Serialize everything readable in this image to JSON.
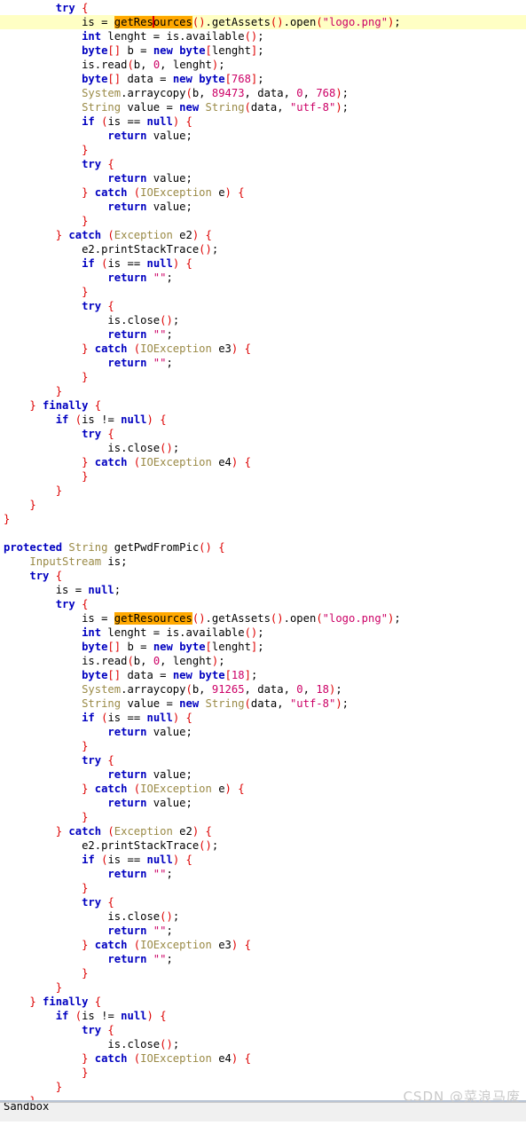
{
  "editor": {
    "language": "java",
    "current_line_index": 1,
    "caret": {
      "line_index": 1,
      "token": "getRes|ources"
    },
    "colors": {
      "background": "#ffffff",
      "current_line_highlight": "#ffffc4",
      "occurrence_highlight": "#ffa800",
      "keyword": "#0000c0",
      "type": "#9a8a46",
      "string": "#cc0066",
      "number": "#cc0066",
      "punctuation": "#dd0000",
      "plain": "#000000",
      "caret": "#e00000",
      "watermark": "#c9c9c9",
      "rule": "#b9c4d4",
      "status_bar": "#f0f0f0"
    },
    "lines": [
      "        try {",
      "            is = getResources().getAssets().open(\"logo.png\");",
      "            int lenght = is.available();",
      "            byte[] b = new byte[lenght];",
      "            is.read(b, 0, lenght);",
      "            byte[] data = new byte[768];",
      "            System.arraycopy(b, 89473, data, 0, 768);",
      "            String value = new String(data, \"utf-8\");",
      "            if (is == null) {",
      "                return value;",
      "            }",
      "            try {",
      "                return value;",
      "            } catch (IOException e) {",
      "                return value;",
      "            }",
      "        } catch (Exception e2) {",
      "            e2.printStackTrace();",
      "            if (is == null) {",
      "                return \"\";",
      "            }",
      "            try {",
      "                is.close();",
      "                return \"\";",
      "            } catch (IOException e3) {",
      "                return \"\";",
      "            }",
      "        }",
      "    } finally {",
      "        if (is != null) {",
      "            try {",
      "                is.close();",
      "            } catch (IOException e4) {",
      "            }",
      "        }",
      "    }",
      "}",
      "",
      "protected String getPwdFromPic() {",
      "    InputStream is;",
      "    try {",
      "        is = null;",
      "        try {",
      "            is = getResources().getAssets().open(\"logo.png\");",
      "            int lenght = is.available();",
      "            byte[] b = new byte[lenght];",
      "            is.read(b, 0, lenght);",
      "            byte[] data = new byte[18];",
      "            System.arraycopy(b, 91265, data, 0, 18);",
      "            String value = new String(data, \"utf-8\");",
      "            if (is == null) {",
      "                return value;",
      "            }",
      "            try {",
      "                return value;",
      "            } catch (IOException e) {",
      "                return value;",
      "            }",
      "        } catch (Exception e2) {",
      "            e2.printStackTrace();",
      "            if (is == null) {",
      "                return \"\";",
      "            }",
      "            try {",
      "                is.close();",
      "                return \"\";",
      "            } catch (IOException e3) {",
      "                return \"\";",
      "            }",
      "        }",
      "    } finally {",
      "        if (is != null) {",
      "            try {",
      "                is.close();",
      "            } catch (IOException e4) {",
      "            }",
      "        }",
      "    }",
      "}"
    ]
  },
  "watermark": {
    "text": "CSDN @菜浪马废"
  },
  "status_bar": {
    "clipped_text": "Sandbox"
  }
}
